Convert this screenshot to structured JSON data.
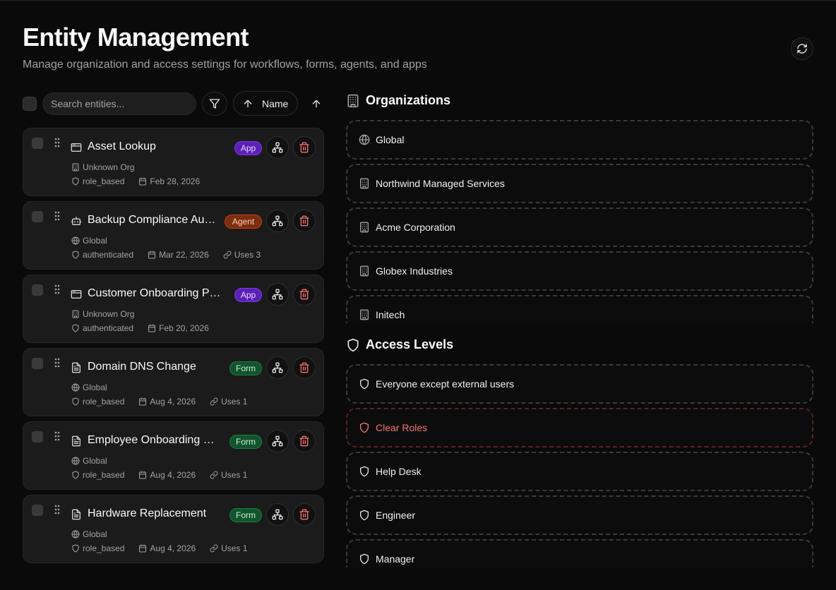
{
  "header": {
    "title": "Entity Management",
    "subtitle": "Manage organization and access settings for workflows, forms, agents, and apps"
  },
  "toolbar": {
    "search_placeholder": "Search entities...",
    "sort_label": "Name"
  },
  "entities": [
    {
      "name": "Asset Lookup",
      "type_icon": "app-window-icon",
      "badge": "App",
      "badge_kind": "app",
      "org_icon": "building-icon",
      "org": "Unknown Org",
      "access": "role_based",
      "date": "Feb 28, 2026",
      "uses": ""
    },
    {
      "name": "Backup Compliance Au…",
      "type_icon": "bot-icon",
      "badge": "Agent",
      "badge_kind": "agent",
      "org_icon": "globe-icon",
      "org": "Global",
      "access": "authenticated",
      "date": "Mar 22, 2026",
      "uses": "Uses 3"
    },
    {
      "name": "Customer Onboarding Po…",
      "type_icon": "app-window-icon",
      "badge": "App",
      "badge_kind": "app",
      "org_icon": "building-icon",
      "org": "Unknown Org",
      "access": "authenticated",
      "date": "Feb 20, 2026",
      "uses": ""
    },
    {
      "name": "Domain DNS Change",
      "type_icon": "file-text-icon",
      "badge": "Form",
      "badge_kind": "form",
      "org_icon": "globe-icon",
      "org": "Global",
      "access": "role_based",
      "date": "Aug 4, 2026",
      "uses": "Uses 1"
    },
    {
      "name": "Employee Onboarding R…",
      "type_icon": "file-text-icon",
      "badge": "Form",
      "badge_kind": "form",
      "org_icon": "globe-icon",
      "org": "Global",
      "access": "role_based",
      "date": "Aug 4, 2026",
      "uses": "Uses 1"
    },
    {
      "name": "Hardware Replacement",
      "type_icon": "file-text-icon",
      "badge": "Form",
      "badge_kind": "form",
      "org_icon": "globe-icon",
      "org": "Global",
      "access": "role_based",
      "date": "Aug 4, 2026",
      "uses": "Uses 1"
    }
  ],
  "organizations": {
    "title": "Organizations",
    "items": [
      {
        "label": "Global",
        "icon": "globe-icon"
      },
      {
        "label": "Northwind Managed Services",
        "icon": "building-icon"
      },
      {
        "label": "Acme Corporation",
        "icon": "building-icon"
      },
      {
        "label": "Globex Industries",
        "icon": "building-icon"
      },
      {
        "label": "Initech",
        "icon": "building-icon"
      }
    ]
  },
  "access_levels": {
    "title": "Access Levels",
    "items": [
      {
        "label": "Everyone except external users",
        "kind": "normal"
      },
      {
        "label": "Clear Roles",
        "kind": "danger"
      },
      {
        "label": "Help Desk",
        "kind": "normal"
      },
      {
        "label": "Engineer",
        "kind": "normal"
      },
      {
        "label": "Manager",
        "kind": "normal"
      }
    ]
  },
  "colors": {
    "background": "#0a0a0a",
    "card": "#1b1b1b",
    "app_badge": "#5b21b6",
    "agent_badge": "#7c2d12",
    "form_badge": "#14532d",
    "danger": "#f87171"
  }
}
